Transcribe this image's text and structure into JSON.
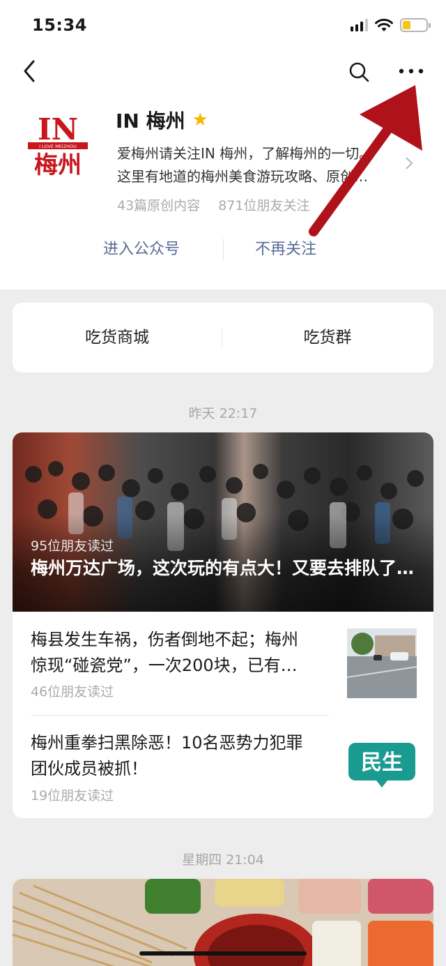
{
  "status_bar": {
    "time": "15:34",
    "battery_level": 0.35
  },
  "nav": {
    "back_icon": "chevron-left-icon",
    "search_icon": "search-icon",
    "more_icon": "more-dots-icon"
  },
  "account": {
    "logo_text_main": "IN",
    "logo_text_small": "I LOVE MEIZHOU",
    "logo_text_cn": "梅州",
    "name": "IN 梅州",
    "badge_icon": "star-icon",
    "description_line1": "爱梅州请关注IN 梅州，了解梅州的一切。",
    "description_line2": "这里有地道的梅州美食游玩攻略、原创…",
    "original_count": "43篇原创内容",
    "followers": "871位朋友关注",
    "enter_label": "进入公众号",
    "unfollow_label": "不再关注"
  },
  "menu": {
    "left": "吃货商城",
    "right": "吃货群"
  },
  "feed": [
    {
      "timestamp": "昨天 22:17",
      "hero": {
        "reads": "95位朋友读过",
        "title": "梅州万达广场，这次玩的有点大！又要去排队了…"
      },
      "items": [
        {
          "title_line1": "梅县发生车祸，伤者倒地不起；梅州",
          "title_line2": "惊现“碰瓷党”，一次200块，已有…",
          "reads": "46位朋友读过"
        },
        {
          "title_line1": "梅州重拳扫黑除恶！10名恶势力犯罪",
          "title_line2": "团伙成员被抓！",
          "reads": "19位朋友读过",
          "thumb_text": "民生"
        }
      ]
    },
    {
      "timestamp": "星期四 21:04"
    }
  ],
  "colors": {
    "link_blue": "#576b95",
    "annotation_red": "#b0121b",
    "logo_red": "#c8161d",
    "minsheng_teal": "#1a9b8f"
  }
}
